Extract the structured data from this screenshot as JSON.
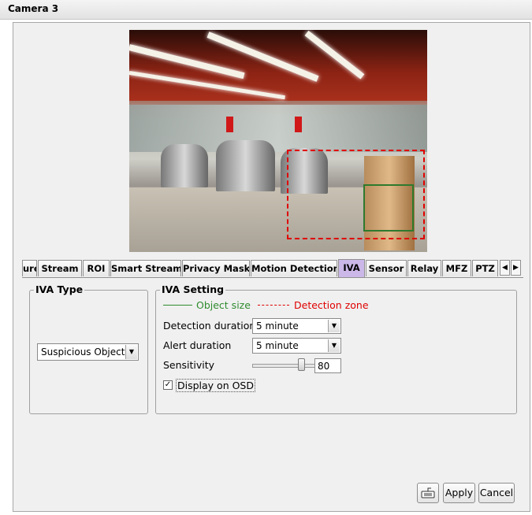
{
  "window": {
    "title": "Camera 3"
  },
  "tabs": [
    {
      "label": "ure"
    },
    {
      "label": "Stream"
    },
    {
      "label": "ROI"
    },
    {
      "label": "Smart Stream"
    },
    {
      "label": "Privacy Mask"
    },
    {
      "label": "Motion Detection"
    },
    {
      "label": "IVA",
      "active": true
    },
    {
      "label": "Sensor"
    },
    {
      "label": "Relay"
    },
    {
      "label": "MFZ"
    },
    {
      "label": "PTZ"
    }
  ],
  "tab_scroll": {
    "left_icon": "chevron-left-icon",
    "right_icon": "chevron-right-icon"
  },
  "iva_type": {
    "group_label": "IVA Type",
    "selected": "Suspicious Object"
  },
  "iva_setting": {
    "group_label": "IVA Setting",
    "legend": {
      "object_size": "Object size",
      "detection_zone": "Detection zone",
      "object_size_color": "#2e8b2e",
      "detection_zone_color": "#e00000"
    },
    "detection_duration": {
      "label": "Detection duration",
      "value": "5 minute"
    },
    "alert_duration": {
      "label": "Alert duration",
      "value": "5 minute"
    },
    "sensitivity": {
      "label": "Sensitivity",
      "value": "80",
      "level_percent": 80
    },
    "display_on_osd": {
      "label": "Display on OSD",
      "checked": true
    }
  },
  "footer": {
    "keyboard_icon": "keyboard-icon",
    "apply_label": "Apply",
    "cancel_label": "Cancel"
  }
}
